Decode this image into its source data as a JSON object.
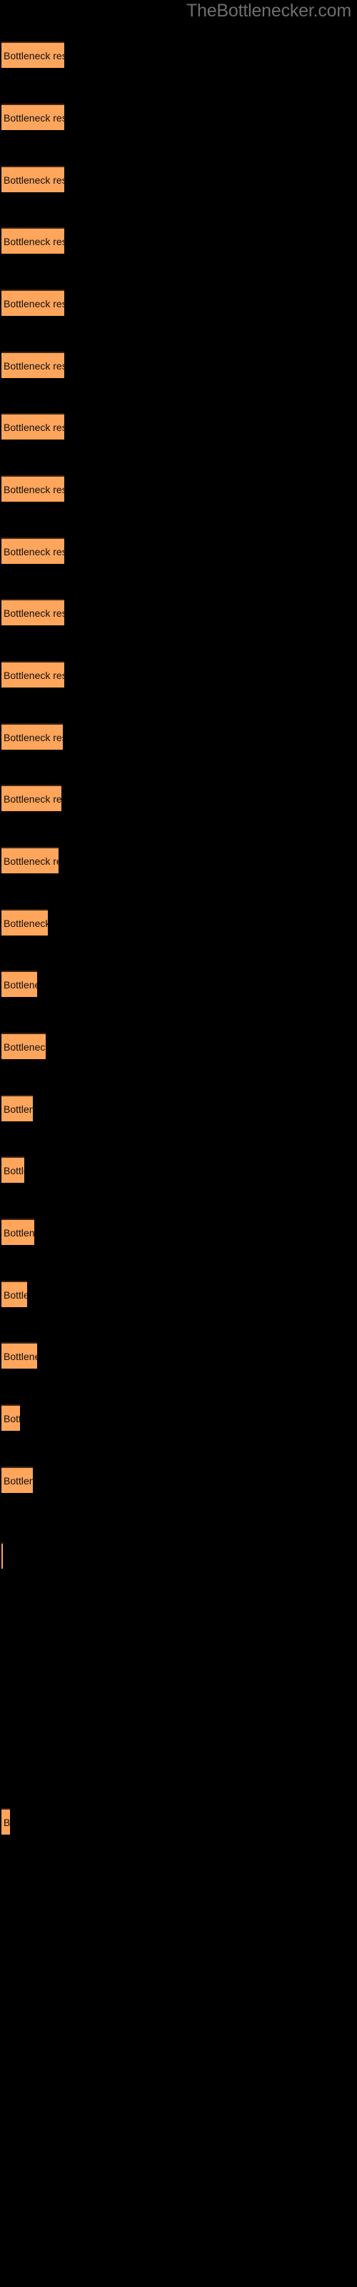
{
  "watermark": "TheBottlenecker.com",
  "colors": {
    "background": "#000000",
    "bar_fill": "#ffa55c",
    "bar_edge": "#3d2415",
    "label_text": "#101010",
    "watermark_text": "#6e6e6e"
  },
  "chart_data": {
    "type": "bar",
    "orientation": "horizontal",
    "title": "",
    "subtitle": "",
    "xlabel": "",
    "ylabel": "",
    "grid": false,
    "legend": null,
    "xlim": [
      0,
      500
    ],
    "bar_label_text": "Bottleneck result",
    "categories": [
      "Bottleneck result",
      "Bottleneck result",
      "Bottleneck result",
      "Bottleneck result",
      "Bottleneck result",
      "Bottleneck result",
      "Bottleneck result",
      "Bottleneck result",
      "Bottleneck result",
      "Bottleneck result",
      "Bottleneck result",
      "Bottleneck result",
      "Bottleneck result",
      "Bottleneck result",
      "Bottleneck result",
      "Bottleneck result",
      "Bottleneck result",
      "Bottleneck result",
      "Bottleneck result",
      "Bottleneck result",
      "Bottleneck result",
      "Bottleneck result",
      "Bottleneck result",
      "Bottleneck result",
      "Bottleneck result",
      "Bottleneck result",
      "Bottleneck result"
    ],
    "values": [
      88,
      88,
      88,
      88,
      88,
      88,
      88,
      88,
      88,
      88,
      88,
      86,
      84,
      80,
      65,
      50,
      62,
      44,
      32,
      46,
      36,
      50,
      26,
      44,
      2,
      0,
      12
    ],
    "bars": [
      {
        "index": 1,
        "y": 58,
        "width": 88,
        "label": "Bottleneck result"
      },
      {
        "index": 2,
        "y": 145,
        "width": 88,
        "label": "Bottleneck result"
      },
      {
        "index": 3,
        "y": 232,
        "width": 88,
        "label": "Bottleneck result"
      },
      {
        "index": 4,
        "y": 318,
        "width": 88,
        "label": "Bottleneck result"
      },
      {
        "index": 5,
        "y": 405,
        "width": 88,
        "label": "Bottleneck result"
      },
      {
        "index": 6,
        "y": 492,
        "width": 88,
        "label": "Bottleneck result"
      },
      {
        "index": 7,
        "y": 578,
        "width": 88,
        "label": "Bottleneck result"
      },
      {
        "index": 8,
        "y": 665,
        "width": 88,
        "label": "Bottleneck result"
      },
      {
        "index": 9,
        "y": 752,
        "width": 88,
        "label": "Bottleneck result"
      },
      {
        "index": 10,
        "y": 838,
        "width": 88,
        "label": "Bottleneck result"
      },
      {
        "index": 11,
        "y": 925,
        "width": 88,
        "label": "Bottleneck result"
      },
      {
        "index": 12,
        "y": 1012,
        "width": 86,
        "label": "Bottleneck result"
      },
      {
        "index": 13,
        "y": 1098,
        "width": 84,
        "label": "Bottleneck result"
      },
      {
        "index": 14,
        "y": 1185,
        "width": 80,
        "label": "Bottleneck result"
      },
      {
        "index": 15,
        "y": 1272,
        "width": 65,
        "label": "Bottleneck result"
      },
      {
        "index": 16,
        "y": 1358,
        "width": 50,
        "label": "Bottleneck result"
      },
      {
        "index": 17,
        "y": 1445,
        "width": 62,
        "label": "Bottleneck result"
      },
      {
        "index": 18,
        "y": 1532,
        "width": 44,
        "label": "Bottleneck result"
      },
      {
        "index": 19,
        "y": 1618,
        "width": 32,
        "label": "Bottleneck result"
      },
      {
        "index": 20,
        "y": 1705,
        "width": 46,
        "label": "Bottleneck result"
      },
      {
        "index": 21,
        "y": 1792,
        "width": 36,
        "label": "Bottleneck result"
      },
      {
        "index": 22,
        "y": 1878,
        "width": 50,
        "label": "Bottleneck result"
      },
      {
        "index": 23,
        "y": 1965,
        "width": 26,
        "label": "Bottleneck result"
      },
      {
        "index": 24,
        "y": 2052,
        "width": 44,
        "label": "Bottleneck result"
      },
      {
        "index": 25,
        "y": 2158,
        "width": 2,
        "label": "Bottleneck result"
      },
      {
        "index": 26,
        "y": 2530,
        "width": 12,
        "label": "Bottleneck result"
      }
    ]
  }
}
